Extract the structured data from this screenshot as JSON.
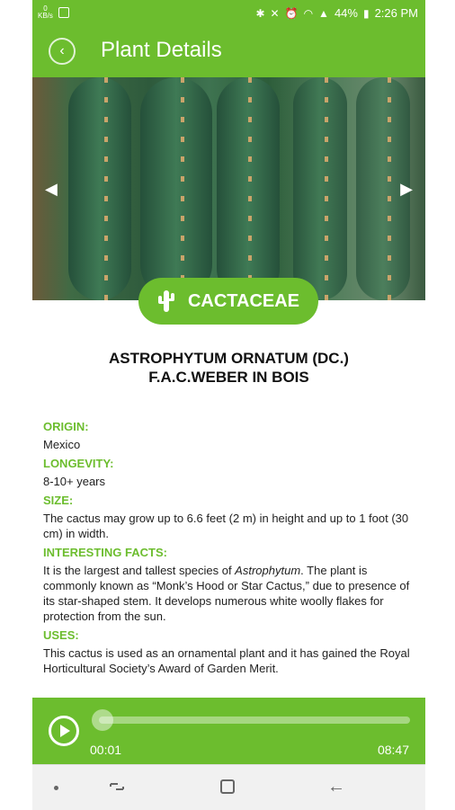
{
  "status_bar": {
    "net_label": "0\nKB/s",
    "battery": "44%",
    "time": "2:26 PM"
  },
  "app_bar": {
    "title": "Plant Details",
    "back_icon": "chevron-left-icon"
  },
  "hero": {
    "prev_icon": "arrow-left-icon",
    "next_icon": "arrow-right-icon"
  },
  "family": {
    "label": "CACTACEAE",
    "icon": "cactus-icon"
  },
  "plant": {
    "name_line1": "ASTROPHYTUM ORNATUM (DC.)",
    "name_line2": "F.A.C.WEBER IN BOIS"
  },
  "details": {
    "origin_label": "ORIGIN:",
    "origin": "Mexico",
    "longevity_label": "LONGEVITY:",
    "longevity": "8-10+ years",
    "size_label": "SIZE:",
    "size": "The cactus may grow up to 6.6 feet (2 m) in height and up to 1 foot (30 cm) in width.",
    "facts_label": "INTERESTING FACTS:",
    "facts_pre": "It is the largest and tallest species of ",
    "facts_italic": "Astrophytum",
    "facts_post": ". The plant is commonly known as “Monk’s Hood or Star Cactus,” due to presence of its star-shaped stem. It develops numerous white woolly flakes for protection from the sun.",
    "uses_label": "USES:",
    "uses": "This cactus is used as an ornamental plant and it has gained the Royal Horticultural Society’s Award of Garden Merit."
  },
  "player": {
    "current_time": "00:01",
    "total_time": "08:47",
    "progress": 0.002
  },
  "colors": {
    "accent": "#6cbd2e"
  }
}
